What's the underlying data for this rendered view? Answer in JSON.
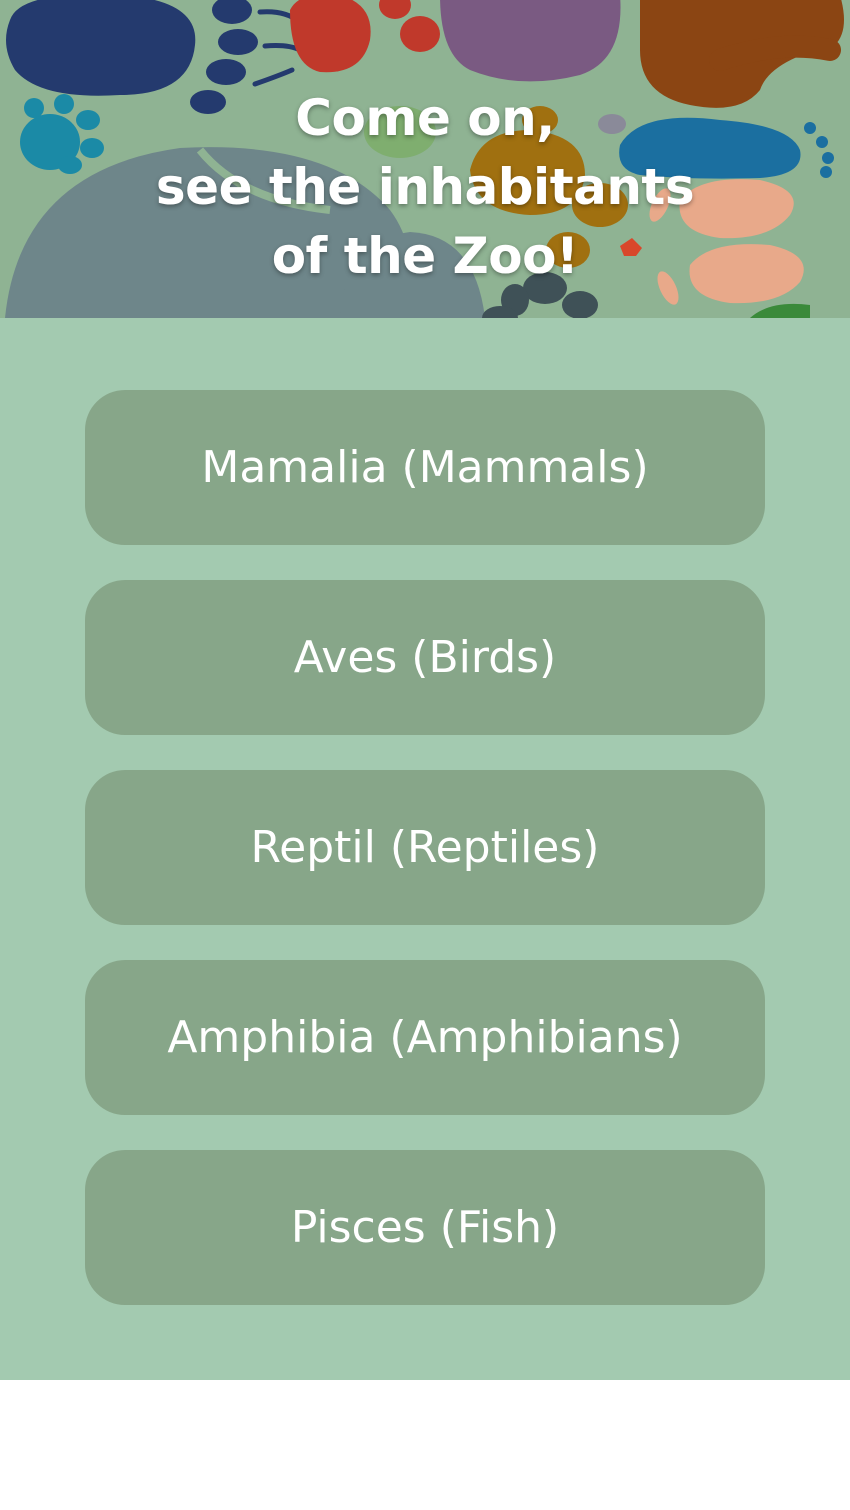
{
  "header": {
    "title_lines": [
      "Come on,",
      "see the inhabitants",
      "of the Zoo!"
    ],
    "background_color": "#8fb393"
  },
  "menu": {
    "background_color": "#a3cab0",
    "button_color": "#87a689",
    "items": [
      {
        "label": "Mamalia (Mammals)"
      },
      {
        "label": "Aves (Birds)"
      },
      {
        "label": "Reptil (Reptiles)"
      },
      {
        "label": "Amphibia (Amphibians)"
      },
      {
        "label": "Pisces (Fish)"
      }
    ]
  }
}
